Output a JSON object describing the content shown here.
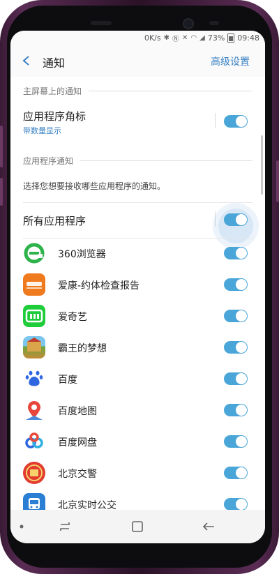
{
  "status_bar": {
    "net_speed": "0K/s",
    "battery": "73%",
    "time": "09:48"
  },
  "header": {
    "title": "通知",
    "advanced": "高级设置"
  },
  "home_screen_section": {
    "label": "主屏幕上的通知",
    "badge_title": "应用程序角标",
    "badge_sub": "带数量显示",
    "badge_on": true
  },
  "app_notifications_section": {
    "label": "应用程序通知",
    "description": "选择您想要接收哪些应用程序的通知。",
    "all_apps": "所有应用程序",
    "all_apps_on": true
  },
  "apps": [
    {
      "name": "360浏览器",
      "icon": "browser-360-icon",
      "on": true
    },
    {
      "name": "爱康-约体检查报告",
      "icon": "ikang-icon",
      "on": true
    },
    {
      "name": "爱奇艺",
      "icon": "iqiyi-icon",
      "on": true
    },
    {
      "name": "霸王的梦想",
      "icon": "game-icon",
      "on": true
    },
    {
      "name": "百度",
      "icon": "baidu-icon",
      "on": true
    },
    {
      "name": "百度地图",
      "icon": "baidu-map-icon",
      "on": true
    },
    {
      "name": "百度网盘",
      "icon": "baidu-netdisk-icon",
      "on": true
    },
    {
      "name": "北京交警",
      "icon": "beijing-police-icon",
      "on": true
    },
    {
      "name": "北京实时公交",
      "icon": "bus-icon",
      "on": true
    }
  ],
  "colors": {
    "accent": "#3a82c4",
    "toggle_on": "#4aa6d8"
  }
}
